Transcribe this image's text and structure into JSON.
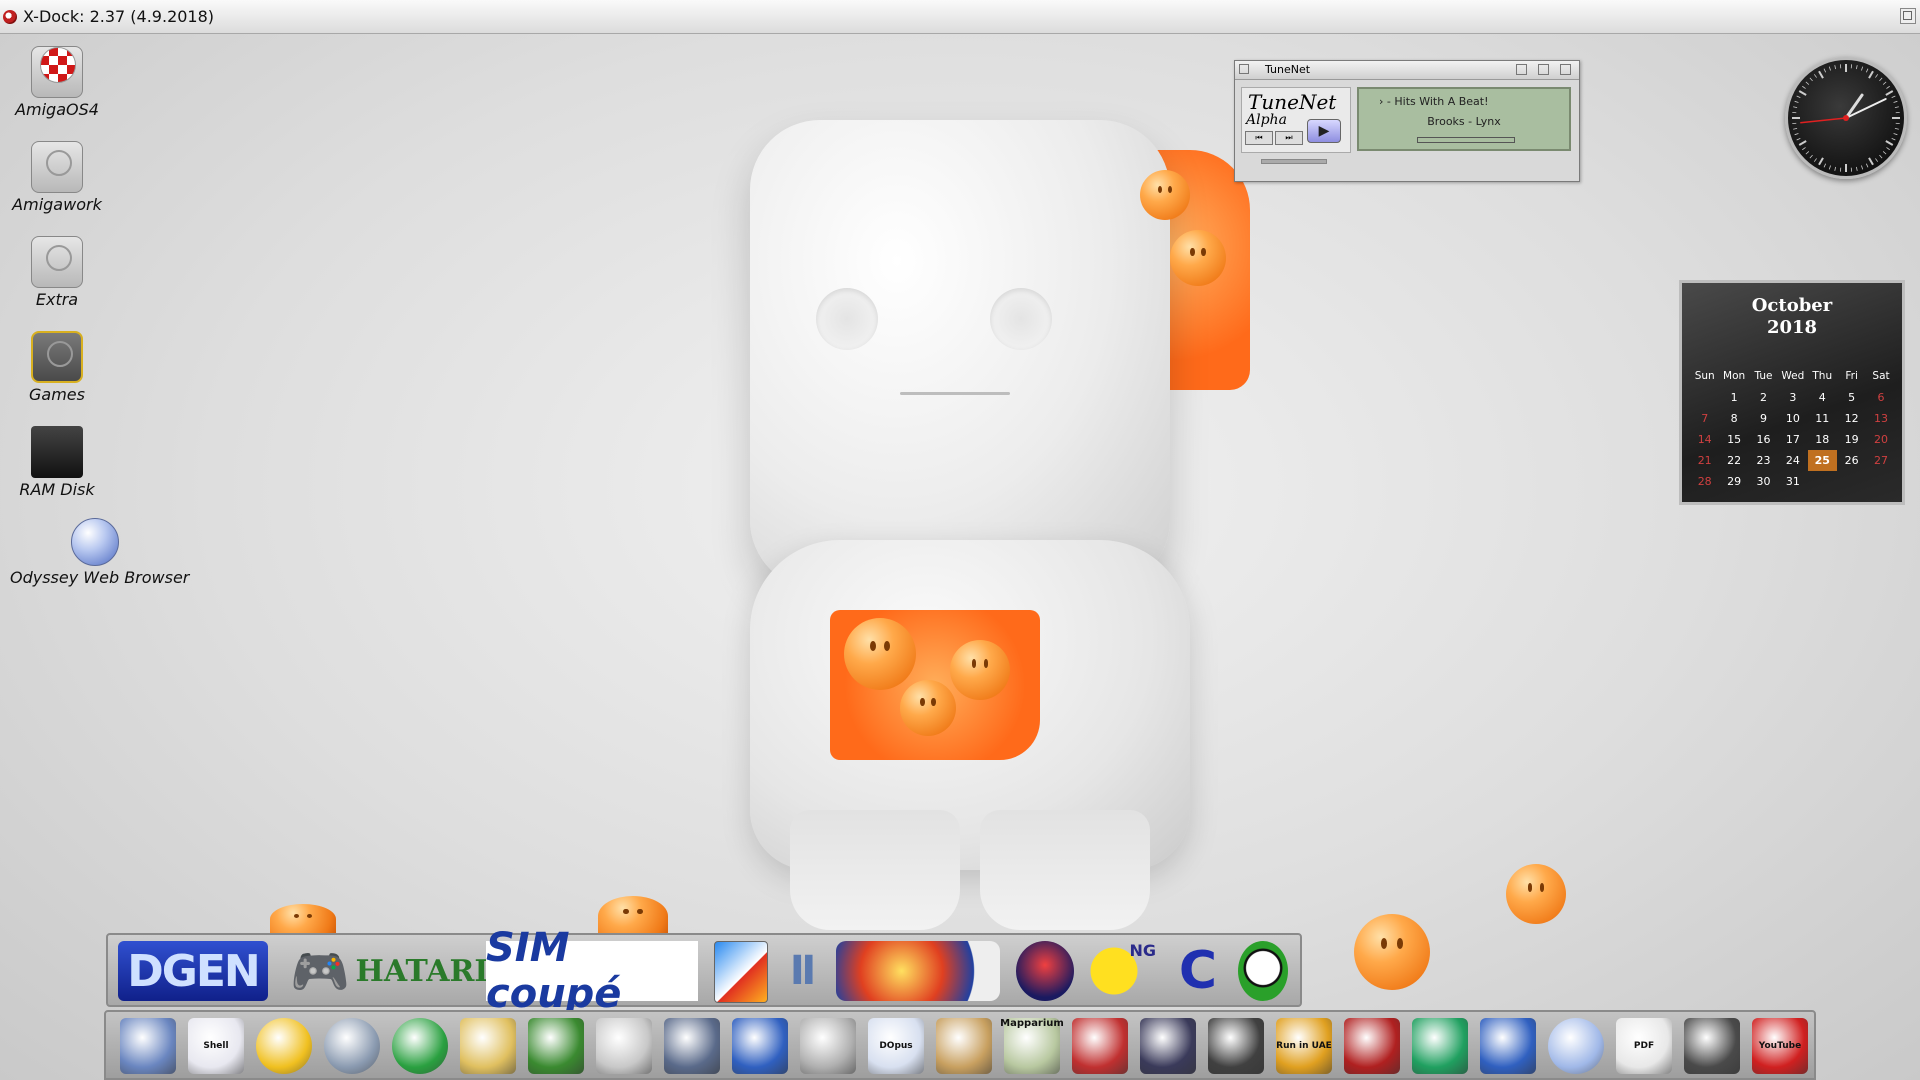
{
  "window": {
    "title": "X-Dock: 2.37 (4.9.2018)"
  },
  "desktop_icons": [
    {
      "label": "AmigaOS4"
    },
    {
      "label": "Amigawork"
    },
    {
      "label": "Extra"
    },
    {
      "label": "Games"
    },
    {
      "label": "RAM Disk"
    },
    {
      "label": "Odyssey Web Browser"
    }
  ],
  "tunenet": {
    "title": "TuneNet",
    "logo_name": "TuneNet",
    "logo_sub": "Alpha",
    "line1": "› - Hits With A Beat!",
    "line2": "Brooks - Lynx",
    "prev_label": "⏮",
    "next_label": "⏭",
    "play_label": "▶"
  },
  "clock": {
    "hour": 1,
    "minute": 10,
    "second": 44
  },
  "calendar": {
    "month": "October",
    "year": "2018",
    "weekdays": [
      "Sun",
      "Mon",
      "Tue",
      "Wed",
      "Thu",
      "Fri",
      "Sat"
    ],
    "weeks": [
      [
        "",
        "1",
        "2",
        "3",
        "4",
        "5",
        "6"
      ],
      [
        "7",
        "8",
        "9",
        "10",
        "11",
        "12",
        "13"
      ],
      [
        "14",
        "15",
        "16",
        "17",
        "18",
        "19",
        "20"
      ],
      [
        "21",
        "22",
        "23",
        "24",
        "25",
        "26",
        "27"
      ],
      [
        "28",
        "29",
        "30",
        "31",
        "",
        "",
        ""
      ]
    ],
    "today": "25"
  },
  "dock_top": {
    "items": [
      {
        "name": "dgen",
        "text": "DGEN"
      },
      {
        "name": "gamepad",
        "text": ""
      },
      {
        "name": "hatari",
        "text": "HATARI"
      },
      {
        "name": "simcoupe",
        "text": "SIM coupé"
      },
      {
        "name": "arcade-a",
        "text": ""
      },
      {
        "name": "atari-logo",
        "text": ""
      },
      {
        "name": "game-collection",
        "text": ""
      },
      {
        "name": "mame",
        "text": ""
      },
      {
        "name": "pacman-ng",
        "text": "NG"
      },
      {
        "name": "commodore",
        "text": ""
      },
      {
        "name": "shyguy",
        "text": ""
      }
    ]
  },
  "dock_bottom": {
    "items": [
      {
        "name": "atari-logo",
        "text": ""
      },
      {
        "name": "shell",
        "text": "Shell"
      },
      {
        "name": "cd-player",
        "text": ""
      },
      {
        "name": "viewer",
        "text": ""
      },
      {
        "name": "download",
        "text": ""
      },
      {
        "name": "folder",
        "text": ""
      },
      {
        "name": "notepad",
        "text": ""
      },
      {
        "name": "camera",
        "text": ""
      },
      {
        "name": "screen-grab",
        "text": ""
      },
      {
        "name": "media-player",
        "text": ""
      },
      {
        "name": "sound",
        "text": ""
      },
      {
        "name": "dopus",
        "text": "DOpus"
      },
      {
        "name": "reader",
        "text": ""
      },
      {
        "name": "mapparium",
        "text": "Mapparium"
      },
      {
        "name": "bag",
        "text": ""
      },
      {
        "name": "monitor",
        "text": ""
      },
      {
        "name": "joystick",
        "text": ""
      },
      {
        "name": "run-in-uae",
        "text": "Run in UAE"
      },
      {
        "name": "game-joystick",
        "text": ""
      },
      {
        "name": "network",
        "text": ""
      },
      {
        "name": "user",
        "text": ""
      },
      {
        "name": "globe",
        "text": ""
      },
      {
        "name": "pdf",
        "text": "PDF"
      },
      {
        "name": "screen",
        "text": ""
      },
      {
        "name": "youtube",
        "text": "YouTube"
      }
    ]
  }
}
